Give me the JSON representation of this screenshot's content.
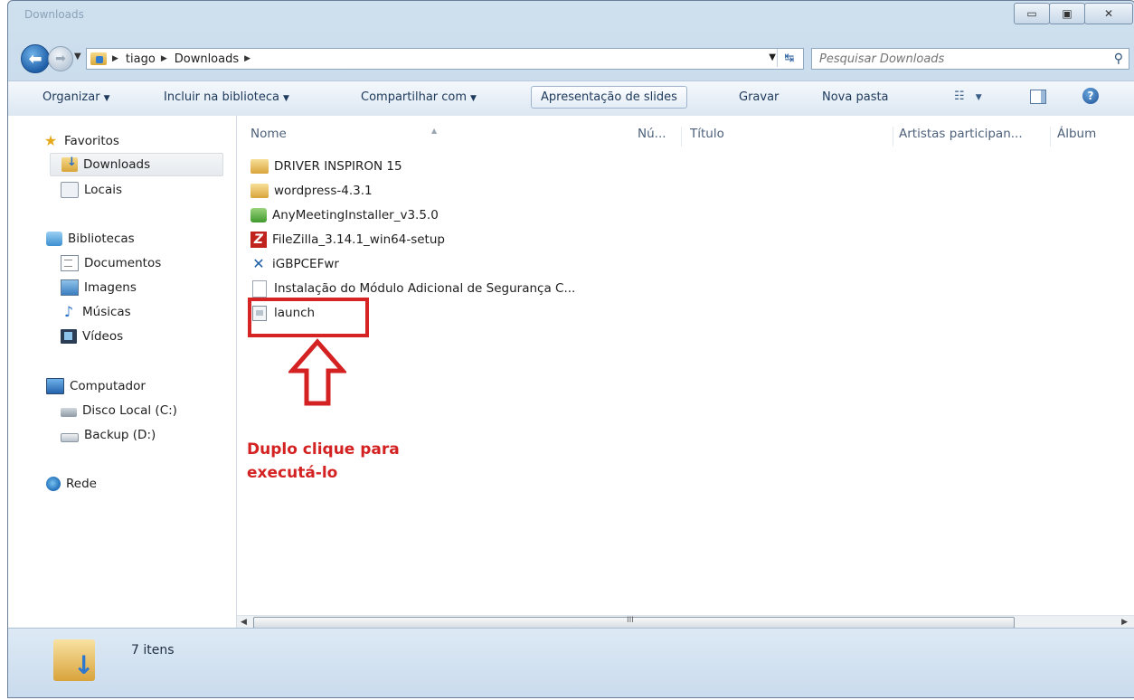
{
  "window": {
    "title": "Downloads",
    "minimize_glyph": "▭",
    "maximize_glyph": "▣",
    "close_glyph": "✕"
  },
  "address": {
    "path": [
      "tiago",
      "Downloads"
    ],
    "search_placeholder": "Pesquisar Downloads"
  },
  "toolbar": {
    "organize": "Organizar",
    "include_library": "Incluir na biblioteca",
    "share_with": "Compartilhar com",
    "slideshow": "Apresentação de slides",
    "burn": "Gravar",
    "new_folder": "Nova pasta"
  },
  "sidebar": {
    "favorites": "Favoritos",
    "downloads": "Downloads",
    "places": "Locais",
    "libraries": "Bibliotecas",
    "documents": "Documentos",
    "images": "Imagens",
    "music": "Músicas",
    "videos": "Vídeos",
    "computer": "Computador",
    "disk_c": "Disco Local (C:)",
    "disk_d": "Backup (D:)",
    "network": "Rede"
  },
  "columns": {
    "name": "Nome",
    "number": "Nú...",
    "title": "Título",
    "artists": "Artistas participan...",
    "album": "Álbum"
  },
  "files": [
    {
      "name": "DRIVER INSPIRON 15",
      "icon": "folder-icon"
    },
    {
      "name": "wordpress-4.3.1",
      "icon": "folder-icon"
    },
    {
      "name": "AnyMeetingInstaller_v3.5.0",
      "icon": "installer-icon"
    },
    {
      "name": "FileZilla_3.14.1_win64-setup",
      "icon": "filezilla-icon"
    },
    {
      "name": "iGBPCEFwr",
      "icon": "x-app-icon"
    },
    {
      "name": "Instalação do Módulo Adicional de Segurança C...",
      "icon": "blank-file-icon"
    },
    {
      "name": "launch",
      "icon": "launch-file-icon"
    }
  ],
  "annotation": {
    "line1": "Duplo clique para",
    "line2": "executá-lo",
    "color": "#d42121"
  },
  "status": {
    "count": "7 itens"
  }
}
